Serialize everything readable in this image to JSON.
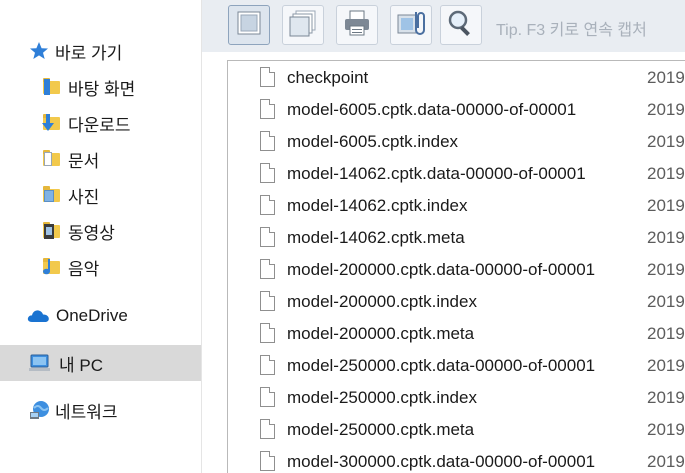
{
  "nav": {
    "quick_access": "바로 가기",
    "desktop": "바탕 화면",
    "downloads": "다운로드",
    "documents": "문서",
    "pictures": "사진",
    "videos": "동영상",
    "music": "음악",
    "onedrive": "OneDrive",
    "this_pc": "내 PC",
    "network": "네트워크"
  },
  "toolbar": {
    "tip": "Tip. F3 키로 연속 캡처",
    "buttons": [
      "capture-window-icon",
      "capture-multi-icon",
      "print-icon",
      "clipboard-icon",
      "magnifier-icon"
    ]
  },
  "files": [
    {
      "name": "checkpoint",
      "date": "2019"
    },
    {
      "name": "model-6005.cptk.data-00000-of-00001",
      "date": "2019"
    },
    {
      "name": "model-6005.cptk.index",
      "date": "2019"
    },
    {
      "name": "model-14062.cptk.data-00000-of-00001",
      "date": "2019"
    },
    {
      "name": "model-14062.cptk.index",
      "date": "2019"
    },
    {
      "name": "model-14062.cptk.meta",
      "date": "2019"
    },
    {
      "name": "model-200000.cptk.data-00000-of-00001",
      "date": "2019"
    },
    {
      "name": "model-200000.cptk.index",
      "date": "2019"
    },
    {
      "name": "model-200000.cptk.meta",
      "date": "2019"
    },
    {
      "name": "model-250000.cptk.data-00000-of-00001",
      "date": "2019"
    },
    {
      "name": "model-250000.cptk.index",
      "date": "2019"
    },
    {
      "name": "model-250000.cptk.meta",
      "date": "2019"
    },
    {
      "name": "model-300000.cptk.data-00000-of-00001",
      "date": "2019"
    }
  ],
  "colors": {
    "selection": "#d9d9d9",
    "toolbar_bg": "#e9edf2",
    "star": "#2f7fd8",
    "folder": "#f2c94c"
  }
}
